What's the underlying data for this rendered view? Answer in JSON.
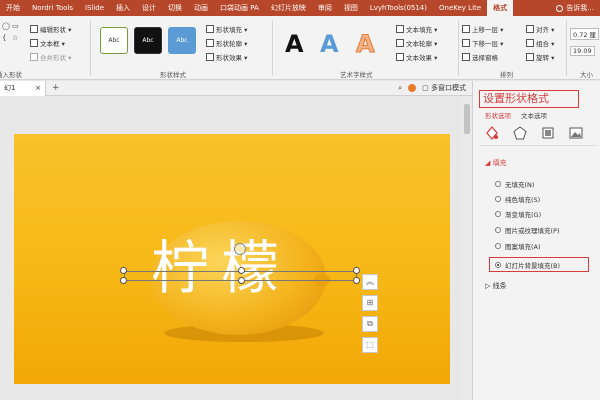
{
  "ribbon_tabs": [
    "开始",
    "Nordri Tools",
    "iSlide",
    "插入",
    "设计",
    "切换",
    "动画",
    "口袋动画 PA",
    "幻灯片放映",
    "审阅",
    "视图",
    "LvyhTools(0514)",
    "OneKey Lite",
    "格式"
  ],
  "active_tab": "格式",
  "tell_me": "告诉我...",
  "ribbon": {
    "insert_shapes": {
      "edit_shape": "编辑形状 ▾",
      "text_box": "文本框 ▾",
      "merge_shapes": "合并形状 ▾",
      "label": "插入形状"
    },
    "shape_styles": {
      "style1": "Abc",
      "style2": "Abc",
      "style3": "Abc",
      "shape_fill": "形状填充 ▾",
      "shape_outline": "形状轮廓 ▾",
      "shape_effects": "形状效果 ▾",
      "label": "形状样式"
    },
    "wordart_styles": {
      "letter": "A",
      "text_fill": "文本填充 ▾",
      "text_outline": "文本轮廓 ▾",
      "text_effects": "文本效果 ▾",
      "label": "艺术字样式"
    },
    "arrange": {
      "bring_forward": "上移一层 ▾",
      "send_backward": "下移一层 ▾",
      "selection_pane": "选择窗格",
      "align": "对齐 ▾",
      "group": "组合 ▾",
      "rotate": "旋转 ▾",
      "label": "排列"
    },
    "size": {
      "height": "0.72 厘",
      "width": "19.09",
      "label": "大小"
    }
  },
  "doc_tab": "幻1",
  "doc_tab_close": "×",
  "doc_plus": "+",
  "multi_window": "多窗口模式",
  "slide_text": "柠檬",
  "side_tools": [
    "︽",
    "⊞",
    "⧉",
    "⬚"
  ],
  "format_pane": {
    "title": "设置形状格式",
    "tabs": [
      "形状选项",
      "文本选项"
    ],
    "fill_section": "填充",
    "fill_options": [
      {
        "label": "无填充(N)",
        "selected": false
      },
      {
        "label": "纯色填充(S)",
        "selected": false
      },
      {
        "label": "渐变填充(G)",
        "selected": false
      },
      {
        "label": "图片或纹理填充(P)",
        "selected": false
      },
      {
        "label": "图案填充(A)",
        "selected": false
      },
      {
        "label": "幻灯片背景填充(B)",
        "selected": true
      }
    ],
    "line_section": "线条"
  },
  "colors": {
    "ribbon_red": "#b7472a",
    "accent_red": "#d83b3b",
    "slide_yellow": "#f6b816"
  }
}
